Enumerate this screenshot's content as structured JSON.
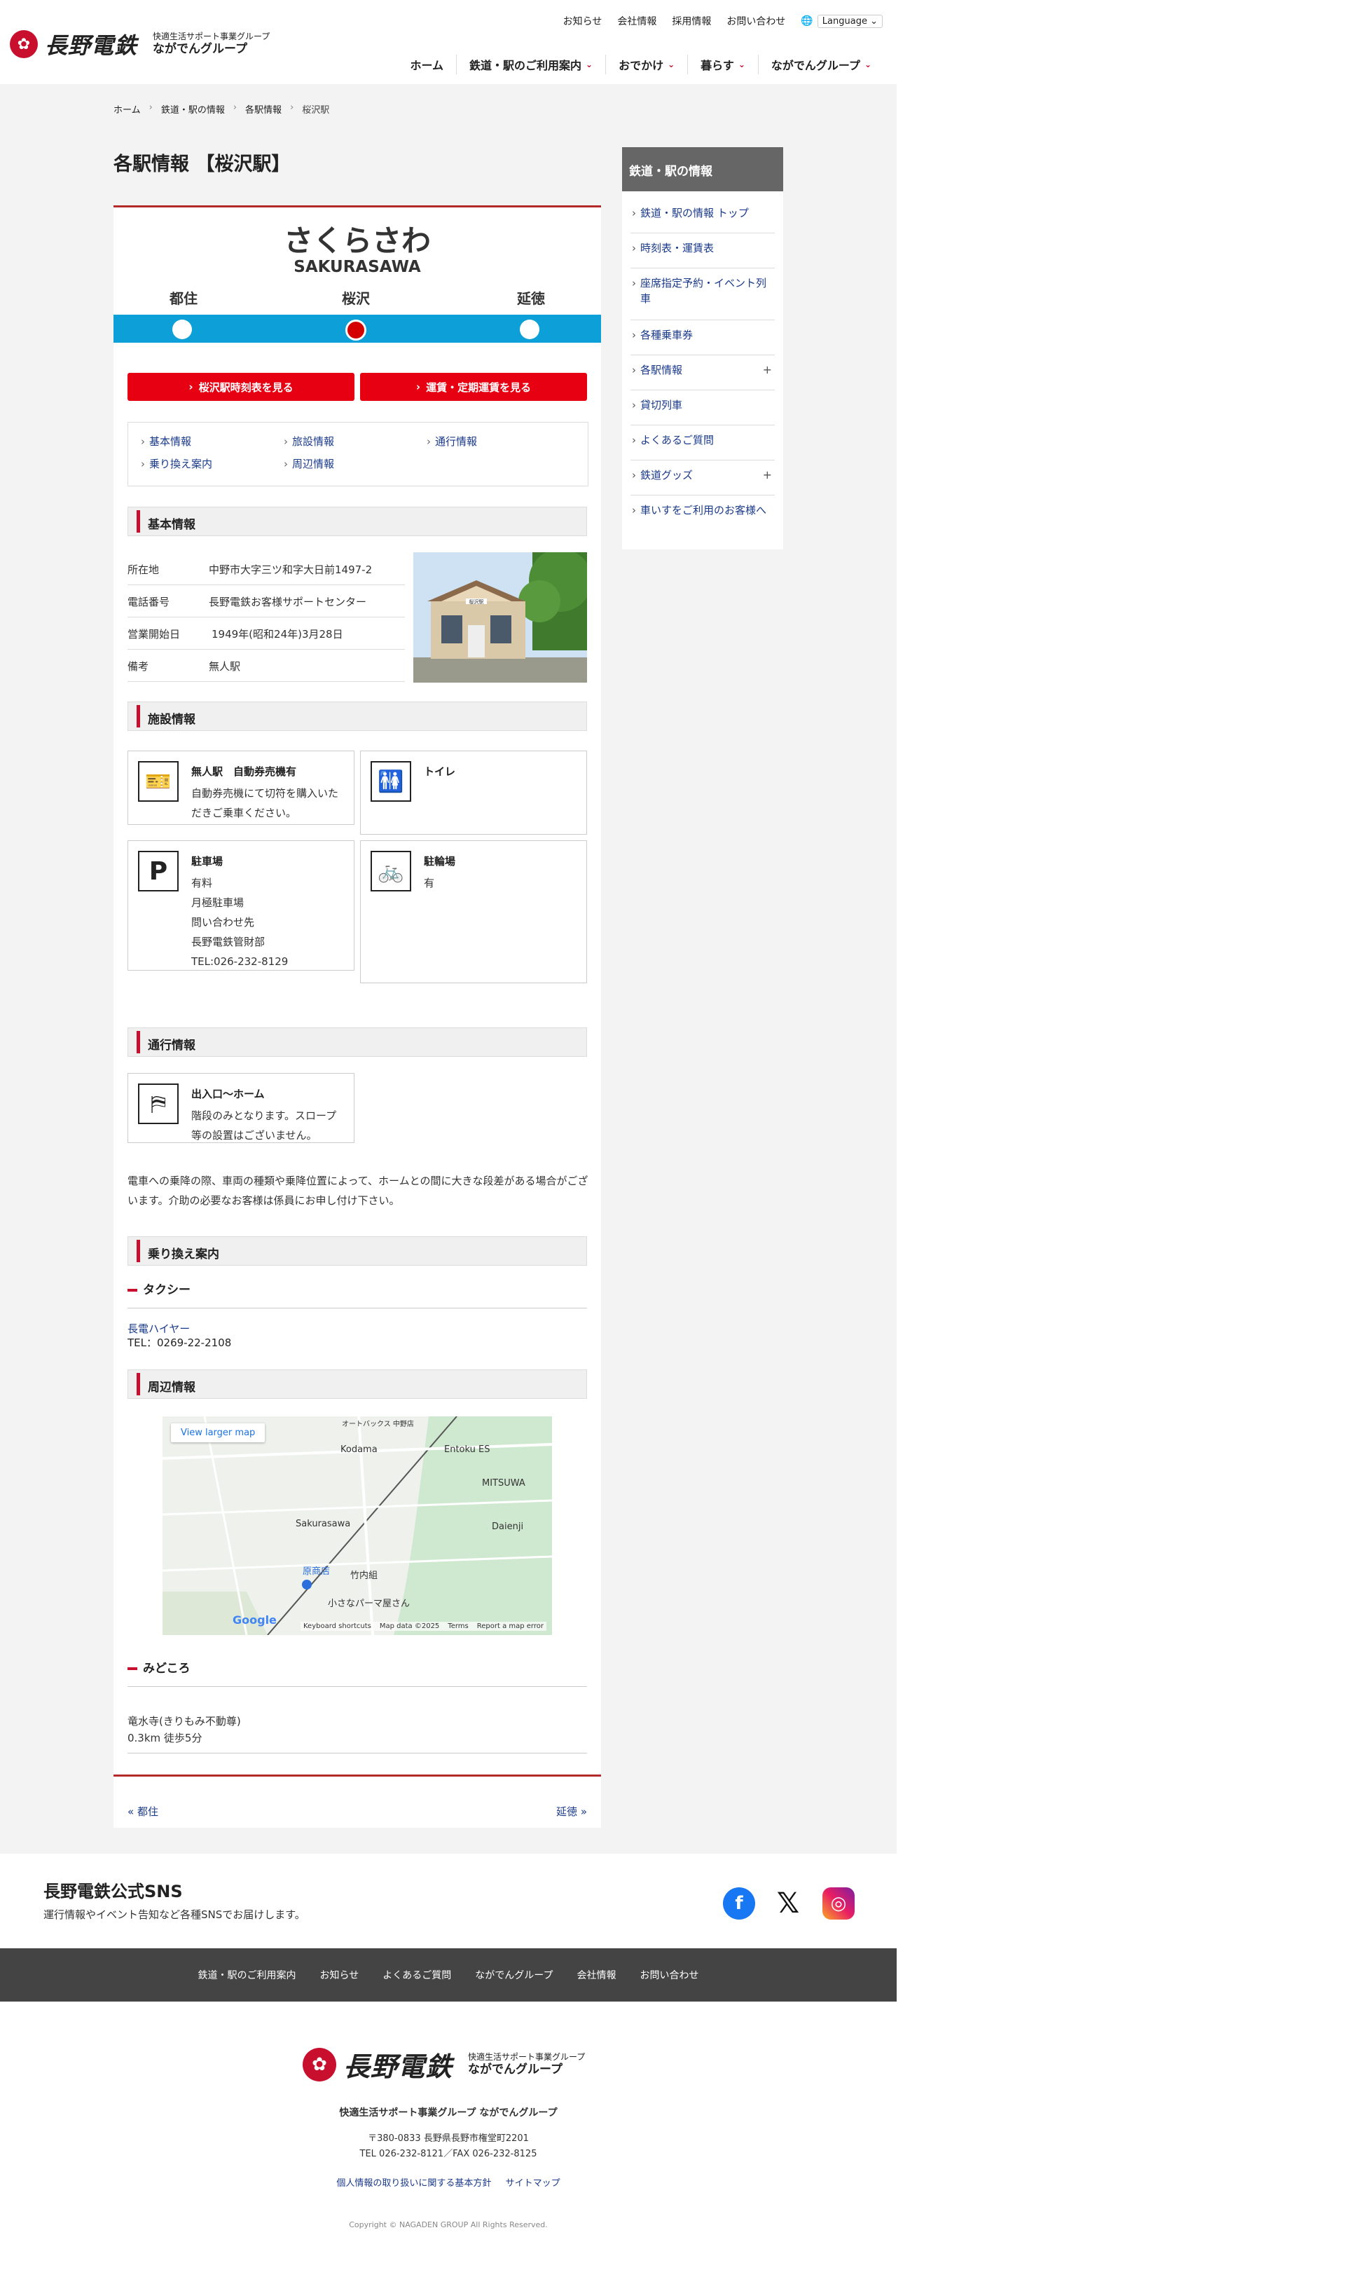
{
  "header": {
    "logo_text": "長野電鉄",
    "logo_sub_top": "快適生活サポート事業グループ",
    "logo_sub_bottom": "ながでんグループ",
    "util_nav": [
      "お知らせ",
      "会社情報",
      "採用情報",
      "お問い合わせ"
    ],
    "language_label": "Language",
    "main_nav": [
      "ホーム",
      "鉄道・駅のご利用案内",
      "おでかけ",
      "暮らす",
      "ながでんグループ"
    ]
  },
  "breadcrumb": [
    "ホーム",
    "鉄道・駅の情報",
    "各駅情報",
    "桜沢駅"
  ],
  "page_title": "各駅情報 【桜沢駅】",
  "station": {
    "kana": "さくらさわ",
    "romaji": "SAKURASAWA",
    "prev": "都住",
    "current": "桜沢",
    "next": "延徳",
    "line_color": "#0d9fd8"
  },
  "buttons": {
    "timetable": "桜沢駅時刻表を見る",
    "fare": "運賃・定期運賃を見る"
  },
  "subnav": [
    "基本情報",
    "旅設情報",
    "通行情報",
    "乗り換え案内",
    "周辺情報"
  ],
  "basic": {
    "heading": "基本情報",
    "rows": [
      {
        "k": "所在地",
        "v": "中野市大字三ツ和字大日前1497-2"
      },
      {
        "k": "電話番号",
        "v": "長野電鉄お客様サポートセンター"
      },
      {
        "k": "営業開始日",
        "v": "1949年(昭和24年)3月28日"
      },
      {
        "k": "備考",
        "v": "無人駅"
      }
    ],
    "photo_sign": "桜沢駅"
  },
  "facilities": {
    "heading": "施設情報",
    "items": [
      {
        "title": "無人駅　自動券売機有",
        "desc": "自動券売機にて切符を購入いただきご乗車ください。",
        "icon": "ticket-machine-icon"
      },
      {
        "title": "トイレ",
        "desc": "",
        "icon": "toilet-icon"
      },
      {
        "title": "駐車場",
        "desc": "有料\n月極駐車場\n問い合わせ先\n長野電鉄管財部\nTEL:026-232-8129",
        "icon": "parking-icon"
      },
      {
        "title": "駐輪場",
        "desc": "有",
        "icon": "bicycle-icon"
      }
    ]
  },
  "access": {
    "heading": "通行情報",
    "title": "出入口〜ホーム",
    "desc": "階段のみとなります。スロープ等の設置はございません。",
    "note": "電車への乗降の際、車両の種類や乗降位置によって、ホームとの間に大きな段差がある場合がございます。介助の必要なお客様は係員にお申し付け下さい。"
  },
  "transfer": {
    "heading": "乗り換え案内",
    "sub": "タクシー",
    "company": "長電ハイヤー",
    "tel": "TEL：0269-22-2108"
  },
  "nearby": {
    "heading": "周辺情報",
    "map_button": "View larger map",
    "map_labels": [
      "Kodama",
      "Entoku ES",
      "MITSUWA",
      "Sakurasawa",
      "Daienji",
      "竹内組",
      "原商店",
      "小さなパーマ屋さん",
      "オートバックス 中野店"
    ],
    "map_footer": [
      "Keyboard shortcuts",
      "Map data ©2025",
      "Terms",
      "Report a map error"
    ],
    "map_logo": "Google",
    "spots_heading": "みどころ",
    "spot_name": "竜水寺(きりもみ不動尊)",
    "spot_dist": "0.3km 徒歩5分"
  },
  "pager": {
    "prev": "« 都住",
    "next": "延徳 »"
  },
  "sidebar": {
    "heading": "鉄道・駅の情報",
    "items": [
      {
        "label": "鉄道・駅の情報 トップ",
        "plus": ""
      },
      {
        "label": "時刻表・運賃表",
        "plus": ""
      },
      {
        "label": "座席指定予約・イベント列車",
        "plus": ""
      },
      {
        "label": "各種乗車券",
        "plus": ""
      },
      {
        "label": "各駅情報",
        "plus": "+"
      },
      {
        "label": "貸切列車",
        "plus": ""
      },
      {
        "label": "よくあるご質問",
        "plus": ""
      },
      {
        "label": "鉄道グッズ",
        "plus": "+"
      },
      {
        "label": "車いすをご利用のお客様へ",
        "plus": ""
      }
    ]
  },
  "sns": {
    "title": "長野電鉄公式SNS",
    "text": "運行情報やイベント告知など各種SNSでお届けします。"
  },
  "footer_nav": [
    "鉄道・駅のご利用案内",
    "お知らせ",
    "よくあるご質問",
    "ながでんグループ",
    "会社情報",
    "お問い合わせ"
  ],
  "footer": {
    "group": "快適生活サポート事業グループ ながでんグループ",
    "address": "〒380-0833 長野県長野市権堂町2201",
    "tel": "TEL 026-232-8121／FAX 026-232-8125",
    "links": [
      "個人情報の取り扱いに関する基本方針",
      "サイトマップ"
    ],
    "copyright": "Copyright © NAGADEN GROUP All Rights Reserved."
  }
}
